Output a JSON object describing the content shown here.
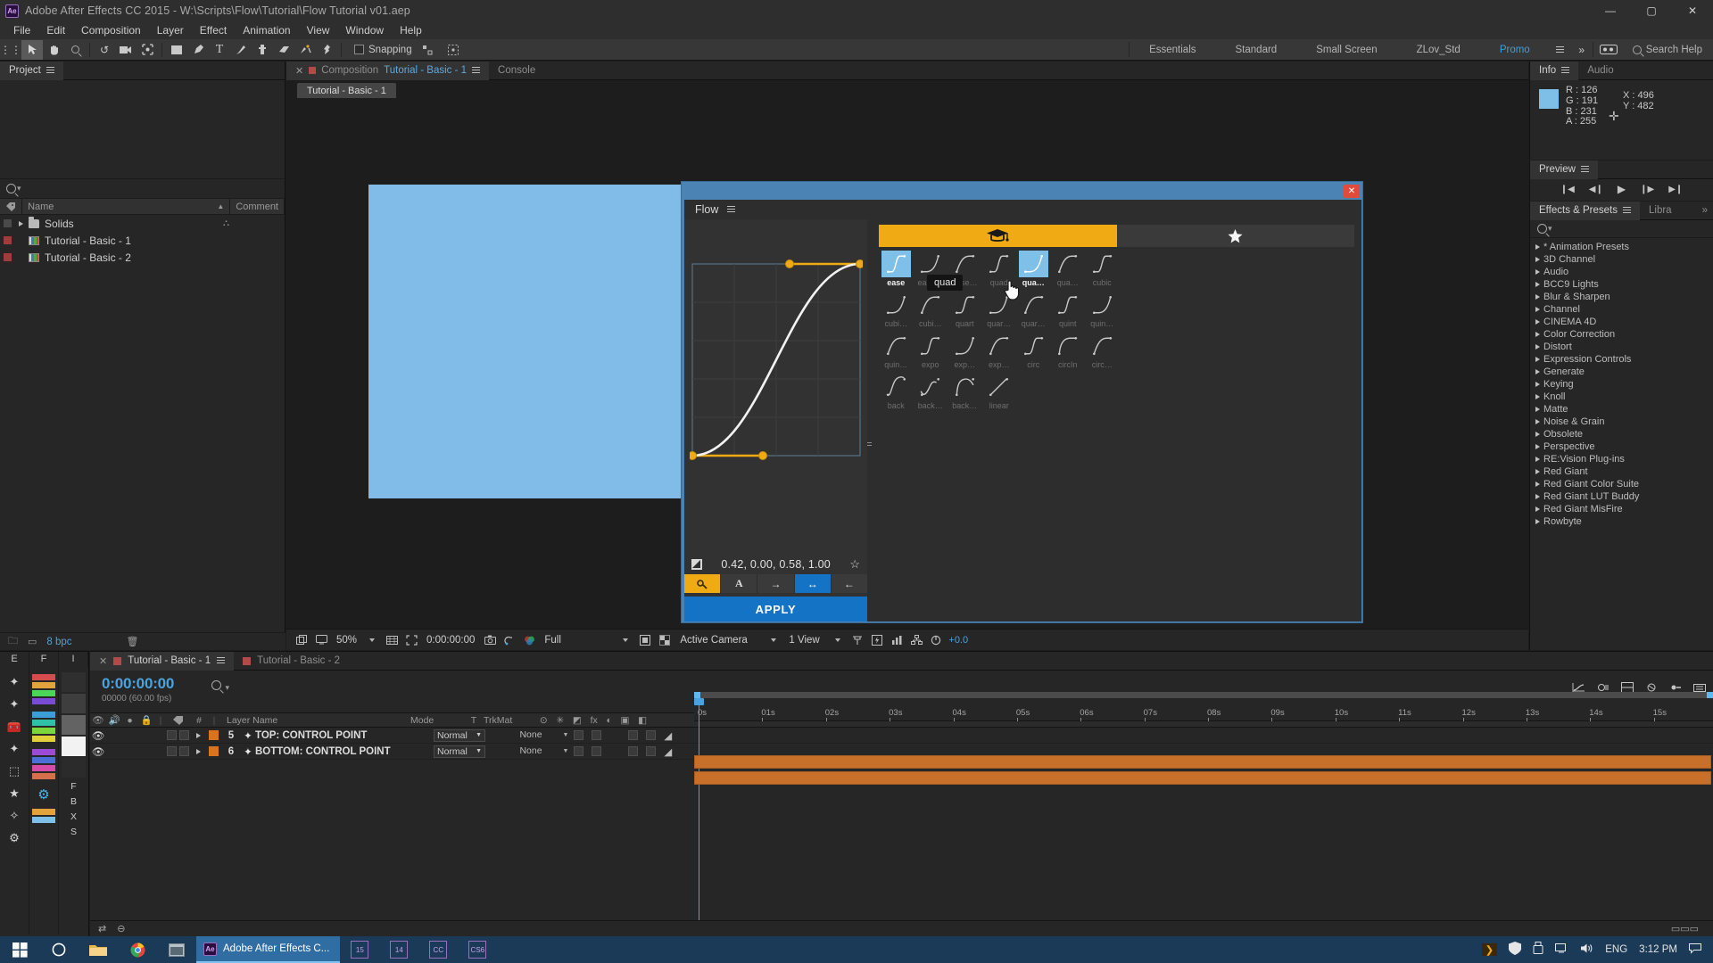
{
  "titlebar": {
    "app_icon": "after-effects-logo",
    "title": "Adobe After Effects CC 2015 - W:\\Scripts\\Flow\\Tutorial\\Flow Tutorial v01.aep",
    "minimize": "—",
    "maximize": "▢",
    "close": "✕"
  },
  "menubar": {
    "items": [
      "File",
      "Edit",
      "Composition",
      "Layer",
      "Effect",
      "Animation",
      "View",
      "Window",
      "Help"
    ]
  },
  "toolbar": {
    "snapping_label": "Snapping",
    "workspaces": [
      "Essentials",
      "Standard",
      "Small Screen",
      "ZLov_Std",
      "Promo"
    ],
    "active_workspace": "Promo",
    "search_help": "Search Help",
    "chevron": "»"
  },
  "project_panel": {
    "tab_label": "Project",
    "columns": [
      "Name",
      "Comment"
    ],
    "items": [
      {
        "name": "Solids",
        "type": "folder",
        "swatch": "grey"
      },
      {
        "name": "Tutorial - Basic - 1",
        "type": "comp",
        "swatch": "red"
      },
      {
        "name": "Tutorial - Basic - 2",
        "type": "comp",
        "swatch": "red"
      }
    ],
    "bpc": "8 bpc"
  },
  "comp_panel": {
    "tabs": [
      {
        "prefix": "Composition",
        "name": "Tutorial - Basic - 1",
        "active": true
      },
      {
        "prefix": "",
        "name": "Console",
        "active": false
      }
    ],
    "subtab": "Tutorial - Basic - 1",
    "footer": {
      "zoom": "50%",
      "timecode": "0:00:00:00",
      "resolution": "Full",
      "camera": "Active Camera",
      "views": "1 View",
      "exposure": "+0.0"
    },
    "canvas_color": "#81bce8"
  },
  "info_panel": {
    "tabs": [
      "Info",
      "Audio"
    ],
    "active_tab": "Info",
    "swatch_color": "#7ebfe7",
    "r": "R : 126",
    "g": "G : 191",
    "b": "B : 231",
    "a": "A : 255",
    "x": "X : 496",
    "y": "Y : 482"
  },
  "preview_panel": {
    "tab_label": "Preview",
    "controls": [
      "first-frame",
      "prev-frame",
      "play",
      "next-frame",
      "last-frame"
    ]
  },
  "effects_presets_panel": {
    "tabs": [
      "Effects & Presets",
      "Libra"
    ],
    "active_tab": "Effects & Presets",
    "chevron": "»",
    "items": [
      "* Animation Presets",
      "3D Channel",
      "Audio",
      "BCC9 Lights",
      "Blur & Sharpen",
      "Channel",
      "CINEMA 4D",
      "Color Correction",
      "Distort",
      "Expression Controls",
      "Generate",
      "Keying",
      "Knoll",
      "Matte",
      "Noise & Grain",
      "Obsolete",
      "Perspective",
      "RE:Vision Plug-ins",
      "Red Giant",
      "Red Giant Color Suite",
      "Red Giant LUT Buddy",
      "Red Giant MisFire",
      "Rowbyte"
    ]
  },
  "left_tools": {
    "headers": [
      "E",
      "F",
      "I"
    ],
    "letters": [
      "F",
      "B",
      "X",
      "S"
    ]
  },
  "timeline": {
    "tabs": [
      {
        "label": "Tutorial - Basic - 1",
        "active": true
      },
      {
        "label": "Tutorial - Basic - 2",
        "active": false
      }
    ],
    "timecode": "0:00:00:00",
    "frames": "00000 (60.00 fps)",
    "columns": [
      "Layer Name",
      "Mode",
      "T",
      "TrkMat"
    ],
    "layers": [
      {
        "num": "5",
        "name": "TOP: CONTROL POINT",
        "mode": "Normal",
        "trkmat": "None"
      },
      {
        "num": "6",
        "name": "BOTTOM: CONTROL POINT",
        "mode": "Normal",
        "trkmat": "None"
      }
    ],
    "ruler_ticks": [
      "0s",
      "01s",
      "02s",
      "03s",
      "04s",
      "05s",
      "06s",
      "07s",
      "08s",
      "09s",
      "10s",
      "11s",
      "12s",
      "13s",
      "14s",
      "15s"
    ]
  },
  "flow_dialog": {
    "title": "Flow",
    "menu_icon": "hamburger-icon",
    "close_label": "✕",
    "tabs": [
      {
        "icon": "graduation-cap-icon",
        "active": true
      },
      {
        "icon": "star-icon",
        "active": false
      }
    ],
    "bezier_value": "0.42, 0.00, 0.58, 1.00",
    "favorite_icon": "star-outline-icon",
    "checkbox_icon": "curve-toggle-icon",
    "buttons": [
      {
        "name": "keyframe-button",
        "icon": "key-icon",
        "style": "gold"
      },
      {
        "name": "text-button",
        "icon": "A",
        "style": "plain"
      },
      {
        "name": "ease-out-button",
        "icon": "→",
        "style": "plain"
      },
      {
        "name": "ease-both-button",
        "icon": "↔",
        "style": "blue"
      },
      {
        "name": "ease-in-button",
        "icon": "←",
        "style": "plain"
      }
    ],
    "apply_label": "APPLY",
    "tooltip": "quad",
    "presets": [
      {
        "label": "ease",
        "shape": "easeInOut",
        "selected": true
      },
      {
        "label": "ease…",
        "shape": "easeIn",
        "selected": false
      },
      {
        "label": "ease…",
        "shape": "easeOut",
        "selected": false
      },
      {
        "label": "quad",
        "shape": "easeInOut",
        "selected": false
      },
      {
        "label": "qua…",
        "shape": "easeIn",
        "selected": true
      },
      {
        "label": "qua…",
        "shape": "easeOut",
        "selected": false
      },
      {
        "label": "cubic",
        "shape": "easeInOut",
        "selected": false
      },
      {
        "label": "cubi…",
        "shape": "easeIn",
        "selected": false
      },
      {
        "label": "cubi…",
        "shape": "easeOut",
        "selected": false
      },
      {
        "label": "quart",
        "shape": "easeInOut",
        "selected": false
      },
      {
        "label": "quar…",
        "shape": "easeIn",
        "selected": false
      },
      {
        "label": "quar…",
        "shape": "easeOut",
        "selected": false
      },
      {
        "label": "quint",
        "shape": "easeInOut",
        "selected": false
      },
      {
        "label": "quin…",
        "shape": "easeIn",
        "selected": false
      },
      {
        "label": "quin…",
        "shape": "easeOut",
        "selected": false
      },
      {
        "label": "expo",
        "shape": "easeInOut",
        "selected": false
      },
      {
        "label": "exp…",
        "shape": "easeIn",
        "selected": false
      },
      {
        "label": "exp…",
        "shape": "easeOut",
        "selected": false
      },
      {
        "label": "circ",
        "shape": "easeInOut",
        "selected": false
      },
      {
        "label": "circIn",
        "shape": "easeIn2",
        "selected": false
      },
      {
        "label": "circ…",
        "shape": "easeOut",
        "selected": false
      },
      {
        "label": "back",
        "shape": "back",
        "selected": false
      },
      {
        "label": "back…",
        "shape": "backIn",
        "selected": false
      },
      {
        "label": "back…",
        "shape": "backOut",
        "selected": false
      },
      {
        "label": "linear",
        "shape": "linear",
        "selected": false
      }
    ]
  },
  "taskbar": {
    "start_icon": "windows-icon",
    "cortana_icon": "cortana-icon",
    "explorer_icon": "file-explorer-icon",
    "chrome_icon": "chrome-icon",
    "terminal_icon": "terminal-icon",
    "active_app": "Adobe After Effects C...",
    "pinned": [
      "15",
      "14",
      "CC",
      "CS6"
    ],
    "tray": [
      "chevron-icon",
      "defender-icon",
      "usb-icon",
      "network-icon",
      "volume-icon"
    ],
    "language": "ENG",
    "time": "3:12 PM",
    "notification_icon": "notification-icon"
  }
}
